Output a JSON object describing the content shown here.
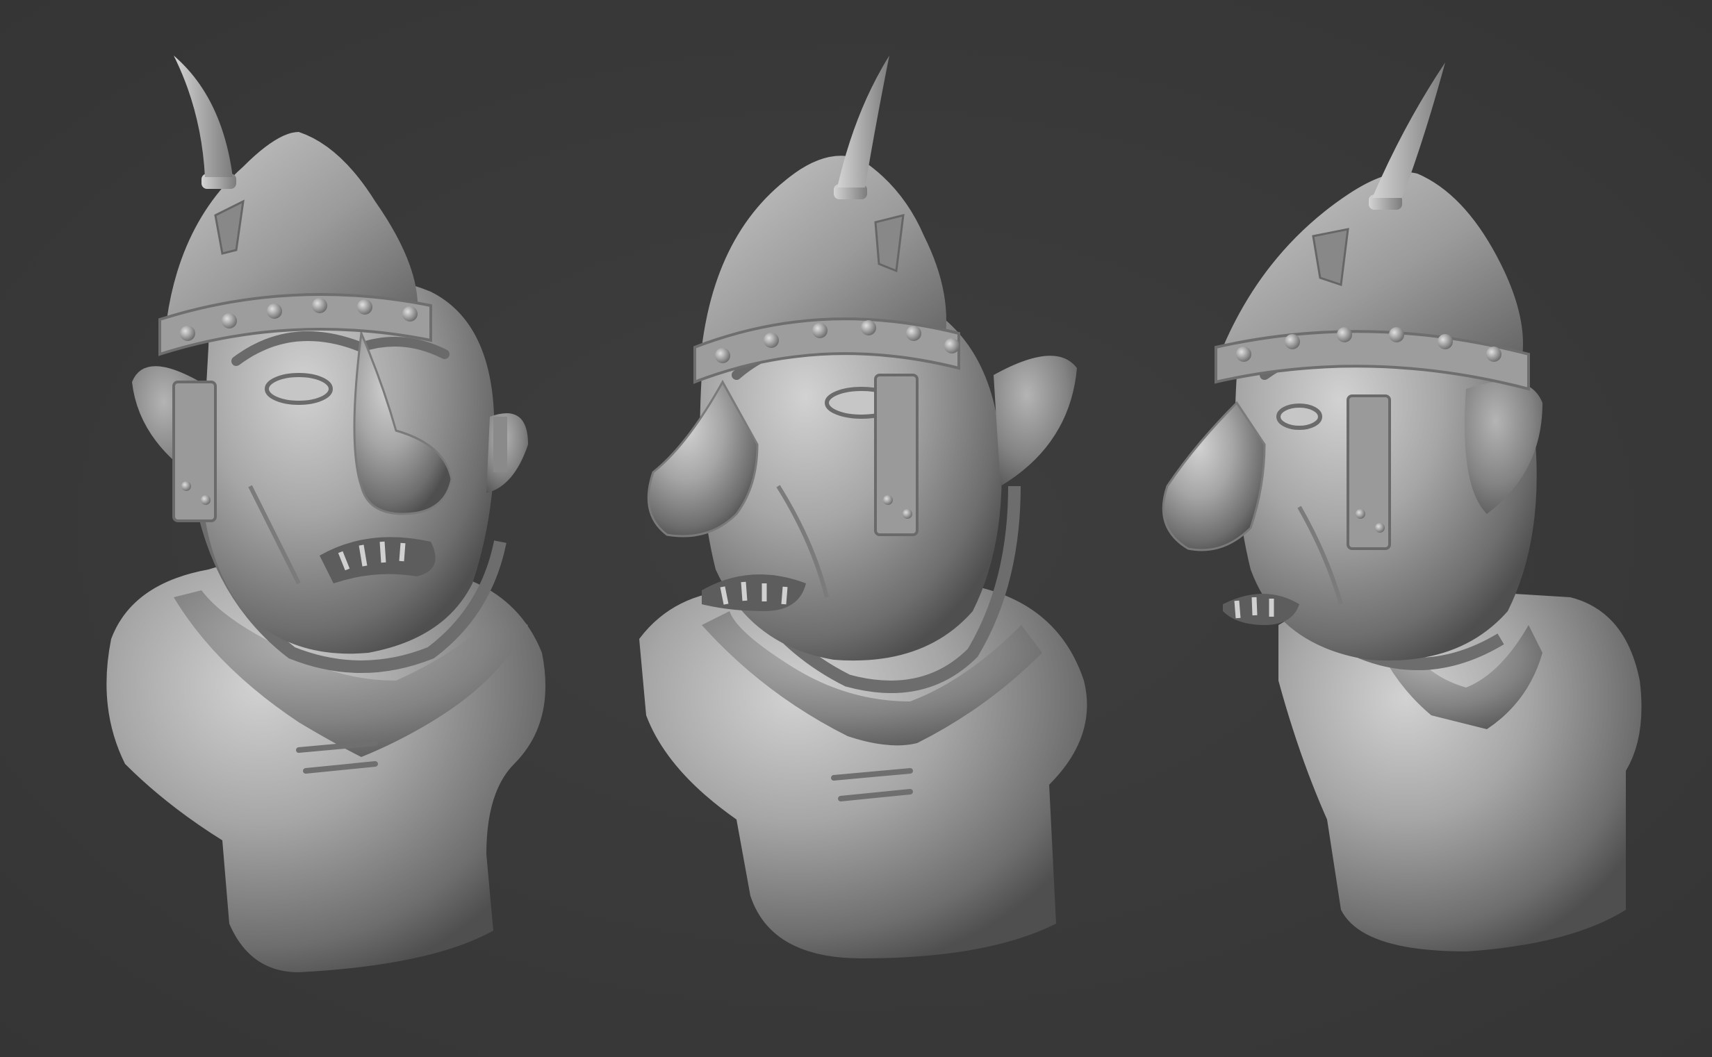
{
  "scene": {
    "background_color": "#3a3a3b",
    "material_color": "#a9a9a9",
    "views": [
      {
        "name": "front",
        "subject": "helmeted-ogre-bust"
      },
      {
        "name": "three-quarter",
        "subject": "helmeted-ogre-bust"
      },
      {
        "name": "profile",
        "subject": "helmeted-ogre-bust"
      }
    ]
  }
}
